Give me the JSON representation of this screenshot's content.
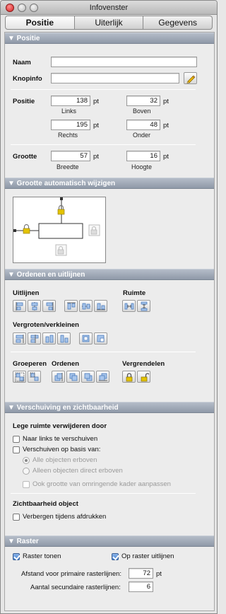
{
  "window": {
    "title": "Infovenster"
  },
  "tabs": [
    {
      "label": "Positie",
      "active": true
    },
    {
      "label": "Uiterlijk",
      "active": false
    },
    {
      "label": "Gegevens",
      "active": false
    }
  ],
  "positie": {
    "header": "▼ Positie",
    "naam_label": "Naam",
    "naam_value": "",
    "knopinfo_label": "Knopinfo",
    "knopinfo_value": "",
    "pencil_icon": "pencil-icon",
    "positie_label": "Positie",
    "links": {
      "value": "138",
      "unit": "pt",
      "caption": "Links"
    },
    "boven": {
      "value": "32",
      "unit": "pt",
      "caption": "Boven"
    },
    "rechts": {
      "value": "195",
      "unit": "pt",
      "caption": "Rechts"
    },
    "onder": {
      "value": "48",
      "unit": "pt",
      "caption": "Onder"
    },
    "grootte_label": "Grootte",
    "breedte": {
      "value": "57",
      "unit": "pt",
      "caption": "Breedte"
    },
    "hoogte": {
      "value": "16",
      "unit": "pt",
      "caption": "Hoogte"
    }
  },
  "auto_resize": {
    "header": "▼ Grootte automatisch wijzigen"
  },
  "arrange": {
    "header": "▼ Ordenen en uitlijnen",
    "uitlijnen": "Uitlijnen",
    "ruimte": "Ruimte",
    "vergroten": "Vergroten/verkleinen",
    "groeperen": "Groeperen",
    "ordenen": "Ordenen",
    "vergrendelen": "Vergrendelen"
  },
  "sliding": {
    "header": "▼ Verschuiving en zichtbaarheid",
    "lege_ruimte": "Lege ruimte verwijderen door",
    "naar_links": {
      "label": "Naar links te verschuiven",
      "checked": false
    },
    "verschuiven": {
      "label": "Verschuiven op basis van:",
      "checked": false
    },
    "alle_objecten": {
      "label": "Alle objecten erboven",
      "selected": true
    },
    "alleen_objecten": {
      "label": "Alleen objecten direct erboven",
      "selected": false
    },
    "ook_grootte": {
      "label": "Ook grootte van omringende kader aanpassen",
      "checked": false
    },
    "zichtbaarheid": "Zichtbaarheid object",
    "verbergen": {
      "label": "Verbergen tijdens afdrukken",
      "checked": false
    }
  },
  "raster": {
    "header": "▼ Raster",
    "raster_tonen": {
      "label": "Raster tonen",
      "checked": true
    },
    "op_raster": {
      "label": "Op raster uitlijnen",
      "checked": true
    },
    "afstand": {
      "label": "Afstand voor primaire rasterlijnen:",
      "value": "72",
      "unit": "pt"
    },
    "aantal": {
      "label": "Aantal secundaire rasterlijnen:",
      "value": "6"
    }
  },
  "colors": {
    "header_bg": "#9aa3b1",
    "accent": "#3f7fd2",
    "lock": "#d8b400"
  }
}
